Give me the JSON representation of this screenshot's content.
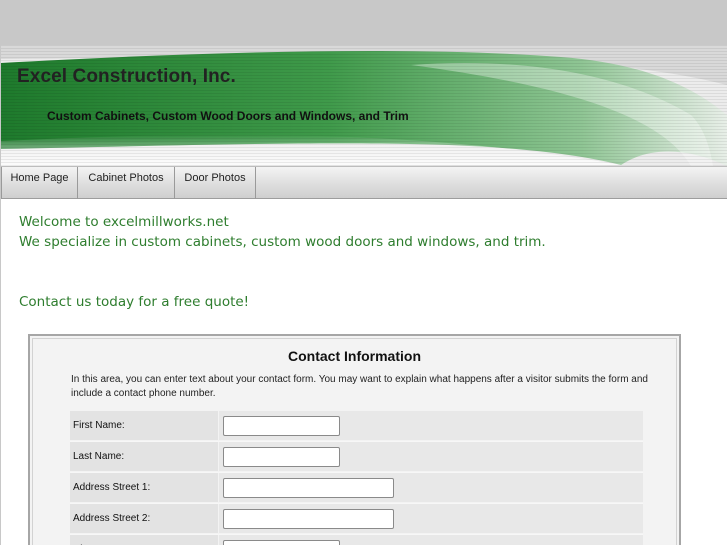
{
  "header": {
    "title": "Excel Construction, Inc.",
    "tagline": "Custom Cabinets, Custom Wood Doors and Windows, and Trim"
  },
  "nav": {
    "items": [
      {
        "label": "Home Page"
      },
      {
        "label": "Cabinet Photos"
      },
      {
        "label": "Door Photos"
      }
    ]
  },
  "content": {
    "welcome": "Welcome to excelmillworks.net",
    "specialize": "We specialize in custom cabinets, custom wood doors and windows, and trim.",
    "cta": "Contact us today for a free quote!"
  },
  "form": {
    "title": "Contact Information",
    "description": "In this area, you can enter text about your contact form. You may want to explain what happens after a visitor submits the form and include a contact phone number.",
    "fields": [
      {
        "label": "First Name:",
        "value": "",
        "placeholder": ""
      },
      {
        "label": "Last Name:",
        "value": "",
        "placeholder": ""
      },
      {
        "label": "Address Street 1:",
        "value": "",
        "placeholder": ""
      },
      {
        "label": "Address Street 2:",
        "value": "",
        "placeholder": ""
      },
      {
        "label": "City:",
        "value": "",
        "placeholder": ""
      }
    ]
  },
  "colors": {
    "background": "#c8c8c8",
    "banner_green": "#2f8a3c",
    "content_text": "#2e7d2e"
  }
}
